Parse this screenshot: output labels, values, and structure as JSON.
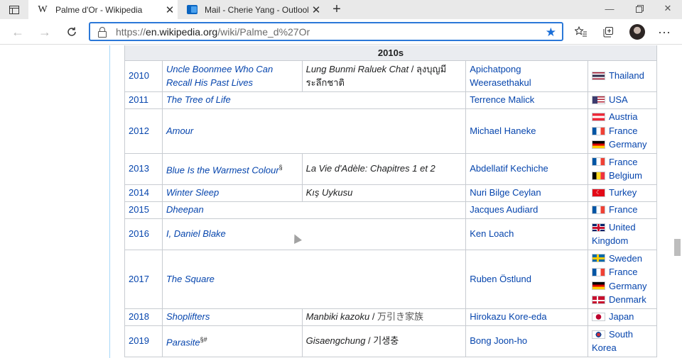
{
  "browser": {
    "tabs": [
      {
        "title": "Palme d'Or - Wikipedia",
        "icon": "wikipedia-icon",
        "active": true
      },
      {
        "title": "Mail - Cherie Yang - Outlook",
        "icon": "outlook-icon",
        "active": false
      }
    ],
    "url_prefix": "https://",
    "url_host": "en.wikipedia.org",
    "url_path": "/wiki/Palme_d%27Or",
    "accent": "#2b78d8"
  },
  "table": {
    "section_header": "2010s",
    "rows": [
      {
        "year": "2010",
        "film": "Uncle Boonmee Who Can Recall His Past Lives",
        "film_mark": "",
        "original": "Lung Bunmi Raluek Chat",
        "original_native": "ลุงบุญมีระลึกชาติ",
        "director": "Apichatpong Weerasethakul",
        "nations": [
          {
            "name": "Thailand",
            "flag": "thailand"
          }
        ]
      },
      {
        "year": "2011",
        "film": "The Tree of Life",
        "film_mark": "",
        "original": "",
        "original_native": "",
        "director": "Terrence Malick",
        "nations": [
          {
            "name": "USA",
            "flag": "usa"
          }
        ]
      },
      {
        "year": "2012",
        "film": "Amour",
        "film_mark": "",
        "original": "",
        "original_native": "",
        "director": "Michael Haneke",
        "nations": [
          {
            "name": "Austria",
            "flag": "austria"
          },
          {
            "name": "France",
            "flag": "france"
          },
          {
            "name": "Germany",
            "flag": "germany"
          }
        ]
      },
      {
        "year": "2013",
        "film": "Blue Is the Warmest Colour",
        "film_mark": "§",
        "original": "La Vie d'Adèle: Chapitres 1 et 2",
        "original_native": "",
        "director": "Abdellatif Kechiche",
        "nations": [
          {
            "name": "France",
            "flag": "france"
          },
          {
            "name": "Belgium",
            "flag": "belgium"
          }
        ]
      },
      {
        "year": "2014",
        "film": "Winter Sleep",
        "film_mark": "",
        "original": "Kış Uykusu",
        "original_native": "",
        "director": "Nuri Bilge Ceylan",
        "nations": [
          {
            "name": "Turkey",
            "flag": "turkey"
          }
        ]
      },
      {
        "year": "2015",
        "film": "Dheepan",
        "film_mark": "",
        "original": "",
        "original_native": "",
        "director": "Jacques Audiard",
        "nations": [
          {
            "name": "France",
            "flag": "france"
          }
        ]
      },
      {
        "year": "2016",
        "film": "I, Daniel Blake",
        "film_mark": "",
        "original": "",
        "original_native": "",
        "director": "Ken Loach",
        "nations": [
          {
            "name": "United Kingdom",
            "flag": "uk"
          }
        ]
      },
      {
        "year": "2017",
        "film": "The Square",
        "film_mark": "",
        "original": "",
        "original_native": "",
        "director": "Ruben Östlund",
        "nations": [
          {
            "name": "Sweden",
            "flag": "sweden"
          },
          {
            "name": "France",
            "flag": "france"
          },
          {
            "name": "Germany",
            "flag": "germany"
          },
          {
            "name": "Denmark",
            "flag": "denmark"
          }
        ]
      },
      {
        "year": "2018",
        "film": "Shoplifters",
        "film_mark": "",
        "original": "Manbiki kazoku",
        "original_native": "万引き家族",
        "director": "Hirokazu Kore-eda",
        "nations": [
          {
            "name": "Japan",
            "flag": "japan"
          }
        ]
      },
      {
        "year": "2019",
        "film": "Parasite",
        "film_mark": "§#",
        "original": "Gisaengchung",
        "original_native": "기생충",
        "director": "Bong Joon-ho",
        "nations": [
          {
            "name": "South Korea",
            "flag": "south-korea"
          }
        ]
      }
    ]
  }
}
